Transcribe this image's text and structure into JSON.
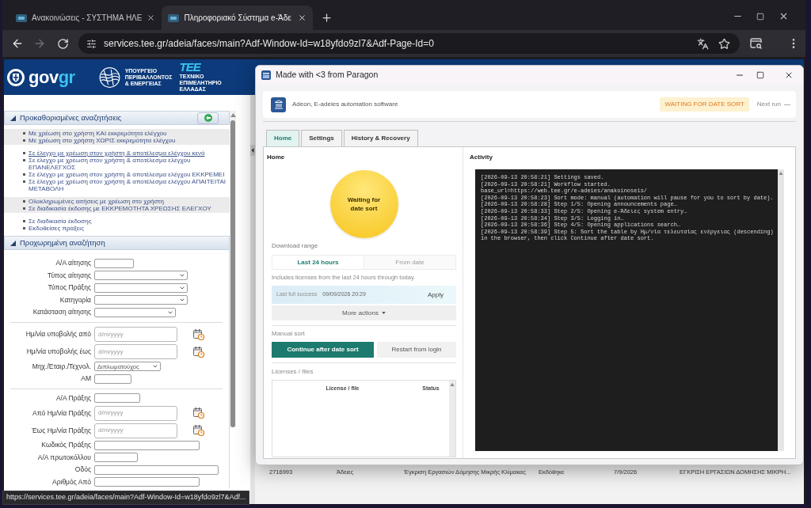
{
  "browser": {
    "tabs": [
      {
        "title": "Ανακοινώσεις - ΣΥΣΤΗΜΑ ΗΛΕ",
        "selected": false
      },
      {
        "title": "Πληροφοριακό Σύστημα e-Άδε",
        "selected": true
      }
    ],
    "forward_disabled": true,
    "address": "services.tee.gr/adeia/faces/main?Adf-Window-Id=w18yfdo9zl7&Adf-Page-Id=0",
    "status_url": "https://services.tee.gr/adeia/faces/main?Adf-Window-Id=w18yfdo9zl7&Adf..."
  },
  "site_header": {
    "logo": {
      "part_1": "gov",
      "part_2": "gr"
    },
    "ministry": [
      "ΥΠΟΥΡΓΕΙΟ",
      "ΠΕΡΙΒΑΛΛΟΝΤΟΣ",
      "& ΕΝΕΡΓΕΙΑΣ"
    ],
    "chamber": {
      "logo": "ΤΕΕ",
      "name": "ΤΕΧΝΙΚΟ ΕΠΙΜΕΛΗΤΗΡΙΟ ΕΛΛΑΔΑΣ"
    }
  },
  "sidebar": {
    "predefined": {
      "title": "Προκαθορισμένες αναζητήσεις",
      "expanded": true,
      "groups": [
        {
          "links": [
            {
              "text": "Με χρέωση στο χρήστη ΚΑΙ εκκρεμότητα ελέγχου",
              "hovered": false
            },
            {
              "text": "Με χρέωση στο χρήστη ΧΩΡΙΣ εκκρεμότητα ελέγχου",
              "hovered": false
            }
          ]
        },
        {
          "links": [
            {
              "text": "Σε έλεγχο με χρέωση στον χρήστη & αποτέλεσμα ελέγχου κενό",
              "hovered": true
            },
            {
              "text": "Σε έλεγχο με χρέωση στον χρήστη & αποτέλεσμα ελέγχου ΕΠΑΝΕΛΕΓΧΟΣ",
              "hovered": false
            },
            {
              "text": "Σε έλεγχο με χρέωση στον χρήστη & αποτέλεσμα ελέγχου ΕΚΚΡΕΜΕΙ",
              "hovered": false
            },
            {
              "text": "Σε έλεγχο με χρέωση στον χρήστη & αποτέλεσμα ελέγχου ΑΠΑΙΤΕΙΤΑΙ ΜΕΤΑΒΟΛΗ",
              "hovered": false
            }
          ]
        },
        {
          "links": [
            {
              "text": "Ολοκληρωμένες αιτήσεις με χρέωση στο χρήστη",
              "hovered": false
            },
            {
              "text": "Σε διαδικασία έκδοσης με ΕΚΚΡΕΜΟΤΗΤΑ ΧΡΕΩΣΗΣ ΕΛΕΓΧΟΥ",
              "hovered": false
            }
          ]
        },
        {
          "links": [
            {
              "text": "Σε διαδικασία έκδοσης",
              "hovered": false
            },
            {
              "text": "Εκδοθείσες πράξεις",
              "hovered": false
            }
          ]
        }
      ]
    },
    "advanced": {
      "title": "Προχωρημένη αναζήτηση",
      "expanded": true,
      "sections": [
        {
          "fields": [
            {
              "label": "Α/Α αίτησης",
              "kind": "text"
            },
            {
              "label": "Τύπος αίτησης",
              "kind": "select"
            },
            {
              "label": "Τύπος Πράξης",
              "kind": "select"
            },
            {
              "label": "Κατηγορία",
              "kind": "select"
            },
            {
              "label": "Κατάσταση αίτησης",
              "kind": "select"
            }
          ]
        },
        {
          "fields": [
            {
              "label": "Ημ/νία υποβολής από",
              "kind": "date",
              "placeholder": "d/m/yyyy"
            },
            {
              "label": "Ημ/νία υποβολής έως",
              "kind": "date",
              "placeholder": "d/m/yyyy"
            },
            {
              "label": "Μηχ./Εταιρ./Τεχνολ.",
              "kind": "select",
              "value": "Διπλωματούχος"
            },
            {
              "label": "ΑΜ",
              "kind": "text"
            }
          ]
        },
        {
          "fields": [
            {
              "label": "Α/Α Πράξης",
              "kind": "text"
            },
            {
              "label": "Από Ημ/νία Πράξης",
              "kind": "date",
              "placeholder": "d/m/yyyy"
            },
            {
              "label": "Έως Ημ/νία Πράξης",
              "kind": "date",
              "placeholder": "d/m/yyyy"
            },
            {
              "label": "Κωδικός Πράξης",
              "kind": "text"
            },
            {
              "label": "Α/Α πρωτοκόλλου",
              "kind": "text"
            },
            {
              "label": "Οδός",
              "kind": "text"
            },
            {
              "label": "Αριθμός Από",
              "kind": "text"
            }
          ]
        }
      ]
    }
  },
  "background_table": {
    "row": [
      "2716993",
      "Άδειες",
      "Έγκριση Εργασιών Δόμησης Μικρής Κλίμακας",
      "Εκδόθηκε",
      "7/9/2026",
      "ΕΓΚΡΙΣΗ ΕΡΓΑΣΙΩΝ ΔΟΜΗΣΗΣ ΜΙΚΡΗ..."
    ]
  },
  "app": {
    "title": "Made with <3 from Paragon",
    "header": {
      "name": "Adeon, E-adeies automation software",
      "status_label": "WAITING FOR DATE SORT",
      "next_run_label": "Next run",
      "next_run": "—"
    },
    "tabs": [
      {
        "label": "Home",
        "selected": true
      },
      {
        "label": "Settings",
        "selected": false
      },
      {
        "label": "History & Recovery",
        "selected": false
      }
    ],
    "home": {
      "title": "Home",
      "status_text": "Waiting for date sort",
      "range_label": "Download range",
      "range_options": [
        {
          "label": "Last 24 hours",
          "selected": true
        },
        {
          "label": "From date",
          "selected": false
        }
      ],
      "range_hint": "Includes licenses from the last 24 hours through today.",
      "last_success_label": "Last full success",
      "last_success": "09/09/2026 20:29",
      "apply": "Apply",
      "more_actions": "More actions",
      "manual_label": "Manual sort",
      "buttons": [
        {
          "label": "Continue after date sort",
          "kind": "primary"
        },
        {
          "label": "Restart from login",
          "kind": "secondary"
        }
      ],
      "files_label": "Licenses / files",
      "files_columns": [
        "License / file",
        "Status"
      ]
    },
    "activity": {
      "title": "Activity",
      "log": [
        "[2026-09-13 20:58:21] Settings saved.",
        "[2026-09-13 20:58:21] Workflow started.",
        "base_url=https://web.tee.gr/e-adeies/anakoinoseis/",
        "[2026-09-13 20:58:23] Sort mode: manual (automation will pause for you to sort by date).",
        "[2026-09-13 20:58:28] Step 1/5: Opening announcements page…",
        "[2026-09-13 20:58:33] Step 2/5: Opening e-Άδειες system entry…",
        "[2026-09-13 20:58:34] Step 3/5: Logging in…",
        "[2026-09-13 20:58:36] Step 4/5: Opening applications search…",
        "[2026-09-13 20:58:39] Step 5: Sort the table by Ημ/νία τελευταίας ενέργειας (descending) in the browser, then click Continue after date sort."
      ]
    }
  }
}
